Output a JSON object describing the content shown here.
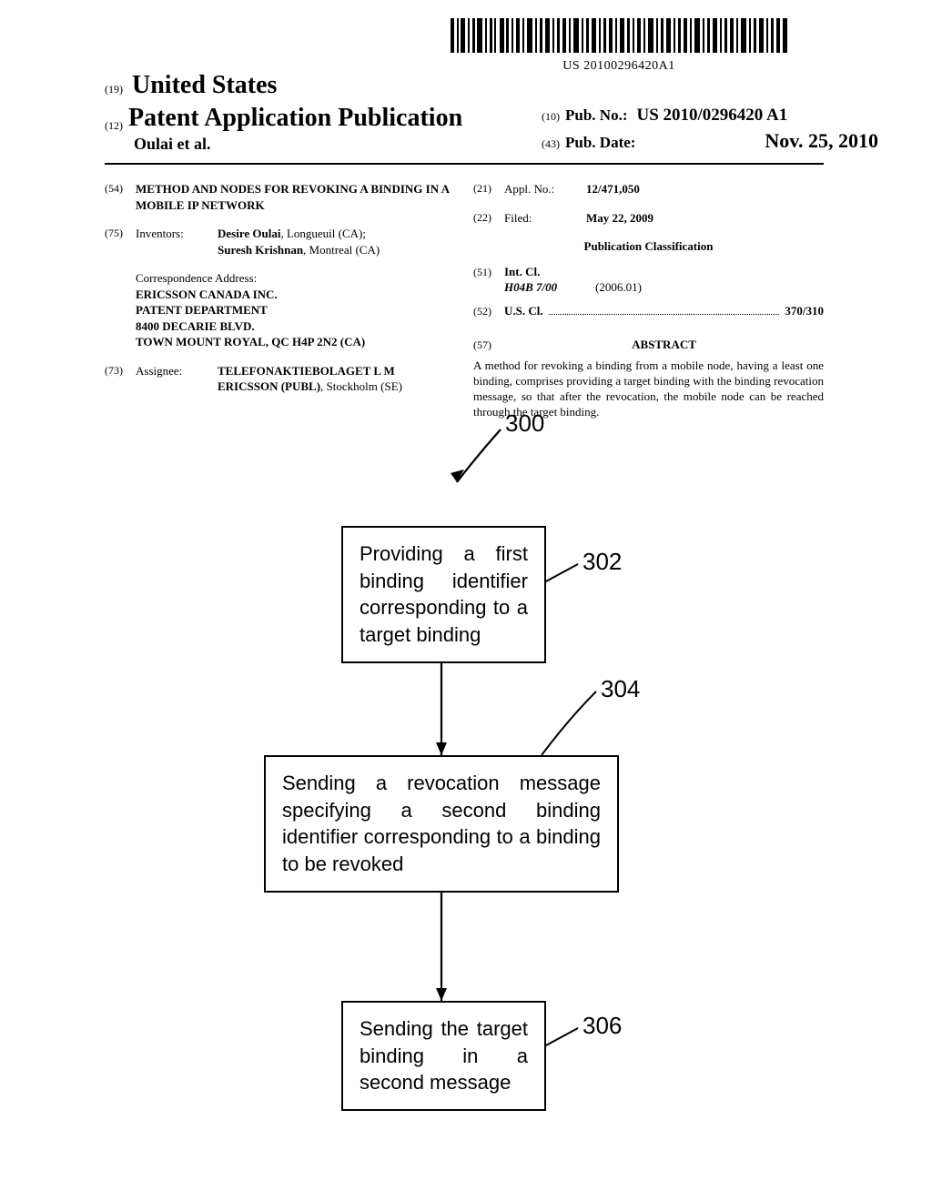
{
  "barcode_text": "US 20100296420A1",
  "header": {
    "num19": "(19)",
    "country": "United States",
    "num12": "(12)",
    "pub_type": "Patent Application Publication",
    "authors_line": "Oulai et al.",
    "num10": "(10)",
    "pubno_label": "Pub. No.:",
    "pubno": "US 2010/0296420 A1",
    "num43": "(43)",
    "pubdate_label": "Pub. Date:",
    "pubdate": "Nov. 25, 2010"
  },
  "left": {
    "f54": {
      "code": "(54)",
      "title": "METHOD AND NODES FOR REVOKING A BINDING IN A MOBILE IP NETWORK"
    },
    "f75": {
      "code": "(75)",
      "label": "Inventors:",
      "inv1_name": "Desire Oulai",
      "inv1_loc": ", Longueuil (CA);",
      "inv2_name": "Suresh Krishnan",
      "inv2_loc": ", Montreal (CA)"
    },
    "corr": {
      "heading": "Correspondence Address:",
      "l1": "ERICSSON CANADA INC.",
      "l2": "PATENT DEPARTMENT",
      "l3": "8400 DECARIE BLVD.",
      "l4": "TOWN MOUNT ROYAL, QC H4P 2N2 (CA)"
    },
    "f73": {
      "code": "(73)",
      "label": "Assignee:",
      "name": "TELEFONAKTIEBOLAGET L M ERICSSON (PUBL)",
      "loc": ", Stockholm (SE)"
    }
  },
  "right": {
    "f21": {
      "code": "(21)",
      "label": "Appl. No.:",
      "value": "12/471,050"
    },
    "f22": {
      "code": "(22)",
      "label": "Filed:",
      "value": "May 22, 2009"
    },
    "classif_heading": "Publication Classification",
    "f51": {
      "code": "(51)",
      "label": "Int. Cl.",
      "class_code": "H04B 7/00",
      "year": "(2006.01)"
    },
    "f52": {
      "code": "(52)",
      "label": "U.S. Cl.",
      "value": "370/310"
    },
    "f57": {
      "code": "(57)",
      "heading": "ABSTRACT",
      "text": "A method for revoking a binding from a mobile node, having a least one binding, comprises providing a target binding with the binding revocation message, so that after the revocation, the mobile node can be reached through the target binding."
    }
  },
  "figure": {
    "ref_main": "300",
    "box302_text": "Providing a first binding identifier corresponding to a target binding",
    "ref302": "302",
    "box304_text": "Sending a revocation message specifying a second binding identifier corresponding to a binding to be revoked",
    "ref304": "304",
    "box306_text": "Sending the target binding in a second message",
    "ref306": "306"
  }
}
